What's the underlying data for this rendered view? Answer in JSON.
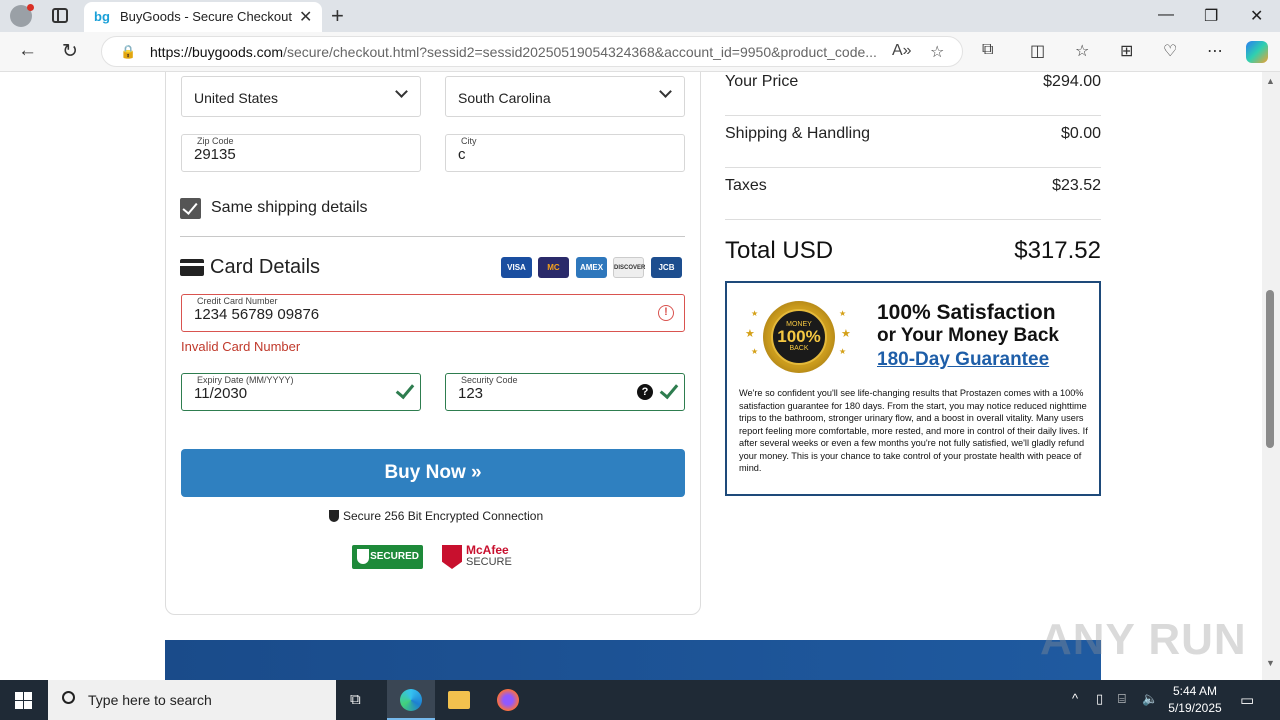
{
  "browser": {
    "tab_title": "BuyGoods - Secure Checkout",
    "url_domain": "https://buygoods.com",
    "url_path": "/secure/checkout.html?sessid2=sessid20250519054324368&account_id=9950&product_code..."
  },
  "form": {
    "country": "United States",
    "state": "South Carolina",
    "zip_label": "Zip Code",
    "zip_value": "29135",
    "city_label": "City",
    "city_value": "c",
    "same_shipping_label": "Same shipping details",
    "same_shipping_checked": true,
    "card_details_title": "Card Details",
    "card_brands": [
      "VISA",
      "MC",
      "AMEX",
      "DISCOVER",
      "JCB"
    ],
    "cc_label": "Credit Card Number",
    "cc_value": "1234 56789 09876",
    "cc_error": "Invalid Card Number",
    "expiry_label": "Expiry Date (MM/YYYY)",
    "expiry_value": "11/2030",
    "cvv_label": "Security Code",
    "cvv_value": "123",
    "buy_button": "Buy Now »",
    "secure_text": "Secure 256 Bit Encrypted Connection",
    "trust_badge": "SECURED",
    "mcafee_badge_1": "McAfee",
    "mcafee_badge_2": "SECURE"
  },
  "summary": {
    "rows": [
      {
        "label": "Your Price",
        "value": "$294.00"
      },
      {
        "label": "Shipping & Handling",
        "value": "$0.00"
      },
      {
        "label": "Taxes",
        "value": "$23.52"
      }
    ],
    "total_label": "Total USD",
    "total_value": "$317.52"
  },
  "guarantee": {
    "seal_top": "MONEY",
    "seal_mid": "100%",
    "seal_bottom": "BACK",
    "title1": "100% Satisfaction",
    "title2": "or Your Money Back",
    "title3": "180-Day Guarantee",
    "body": "We're so confident you'll see life-changing results that Prostazen comes with a 100% satisfaction guarantee for 180 days. From the start, you may notice reduced nighttime trips to the bathroom, stronger urinary flow, and a boost in overall vitality. Many users report feeling more comfortable, more rested, and more in control of their daily lives. If after several weeks or even a few months you're not fully satisfied, we'll gladly refund your money. This is your chance to take control of your prostate health with peace of mind."
  },
  "watermark": "ANY RUN",
  "taskbar": {
    "search_placeholder": "Type here to search",
    "time": "5:44 AM",
    "date": "5/19/2025"
  },
  "colors": {
    "buy_button": "#2f80c0",
    "error": "#d9534f",
    "valid": "#2e7d4f",
    "guarantee_border": "#1e4a7a"
  }
}
